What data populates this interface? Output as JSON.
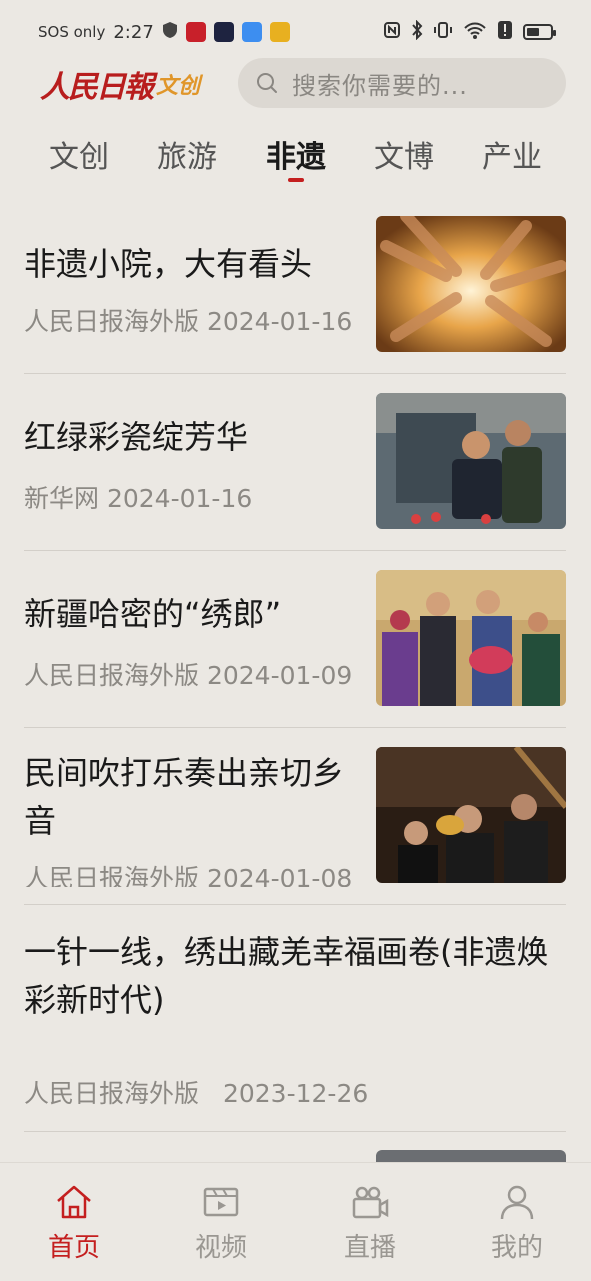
{
  "status_bar": {
    "carrier": "SOS only",
    "time": "2:27"
  },
  "header": {
    "logo_brand": "人民日報",
    "logo_sub": "文创",
    "search_placeholder": "搜索你需要的..."
  },
  "tabs": [
    {
      "label": "文创"
    },
    {
      "label": "旅游"
    },
    {
      "label": "非遗"
    },
    {
      "label": "文博"
    },
    {
      "label": "产业"
    }
  ],
  "active_tab": "非遗",
  "articles": [
    {
      "title": "非遗小院，大有看头",
      "source": "人民日报海外版",
      "date": "2024-01-16"
    },
    {
      "title": "红绿彩瓷绽芳华",
      "source": "新华网",
      "date": "2024-01-16"
    },
    {
      "title": "新疆哈密的“绣郎”",
      "source": "人民日报海外版",
      "date": "2024-01-09"
    },
    {
      "title": "民间吹打乐奏出亲切乡音",
      "source": "人民日报海外版",
      "date": "2024-01-08"
    },
    {
      "title": "一针一线，绣出藏羌幸福画卷(非遗焕彩新时代)",
      "source": "人民日报海外版",
      "date": "2023-12-26"
    }
  ],
  "bottom_nav": [
    {
      "label": "首页"
    },
    {
      "label": "视频"
    },
    {
      "label": "直播"
    },
    {
      "label": "我的"
    }
  ],
  "colors": {
    "accent": "#c41f1f",
    "logo_gold": "#e0962a",
    "background": "#ebe8e3"
  }
}
